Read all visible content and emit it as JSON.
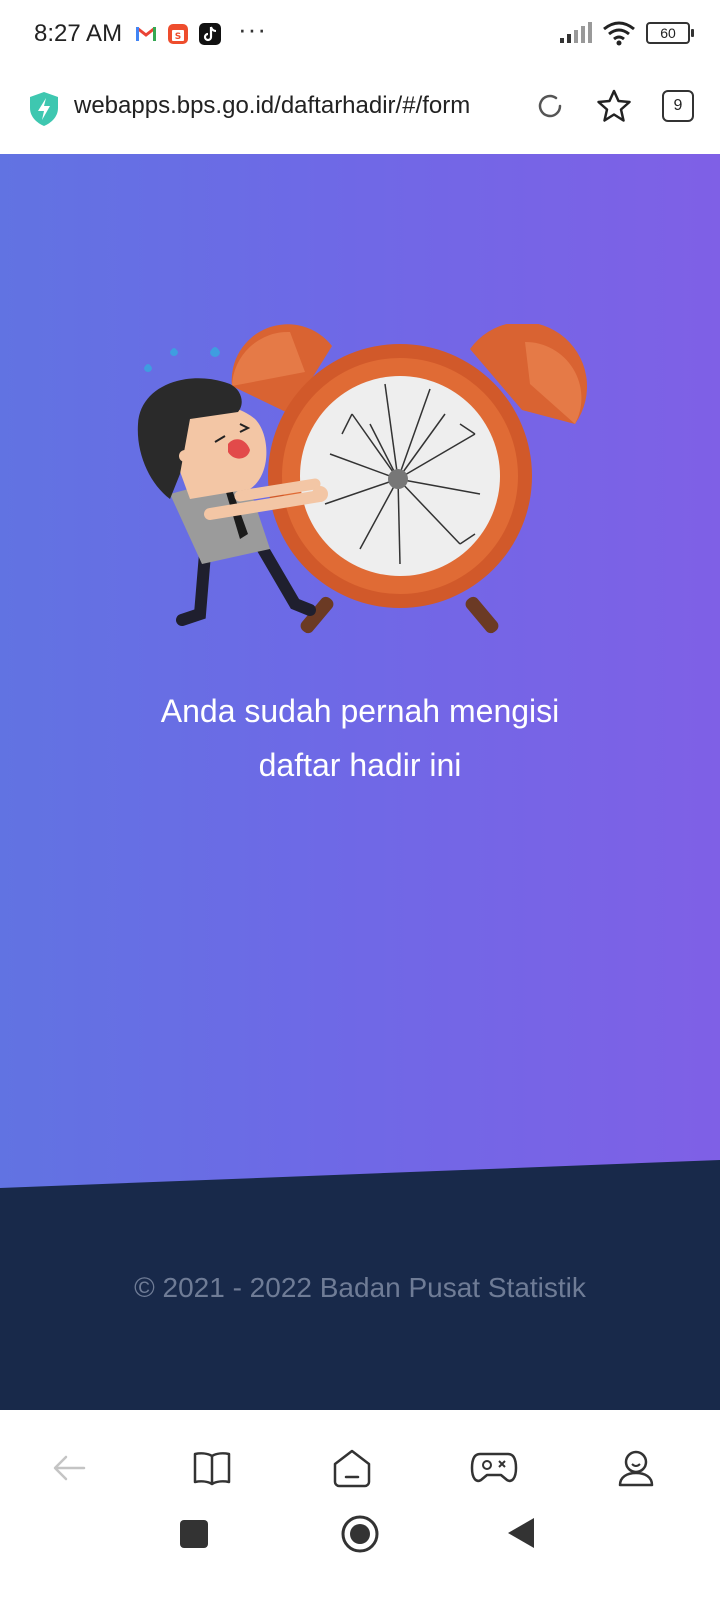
{
  "status_bar": {
    "time": "8:27 AM",
    "app_icons": [
      "gmail-icon",
      "shopee-icon",
      "tiktok-icon"
    ],
    "more": "···",
    "battery": "60"
  },
  "browser": {
    "url": "webapps.bps.go.id/daftarhadir/#/form",
    "tab_count": "9"
  },
  "hero": {
    "message_line1": "Anda sudah pernah mengisi",
    "message_line2": "daftar hadir ini",
    "illustration": "late-man-broken-alarm-clock"
  },
  "footer": {
    "copyright": "© 2021 - 2022 Badan Pusat Statistik"
  },
  "colors": {
    "hero_gradient_start": "#6173e2",
    "hero_gradient_end": "#7f60e6",
    "footer_bg": "#18294a",
    "footer_text": "#6f7c96",
    "clock_orange": "#d96332"
  }
}
